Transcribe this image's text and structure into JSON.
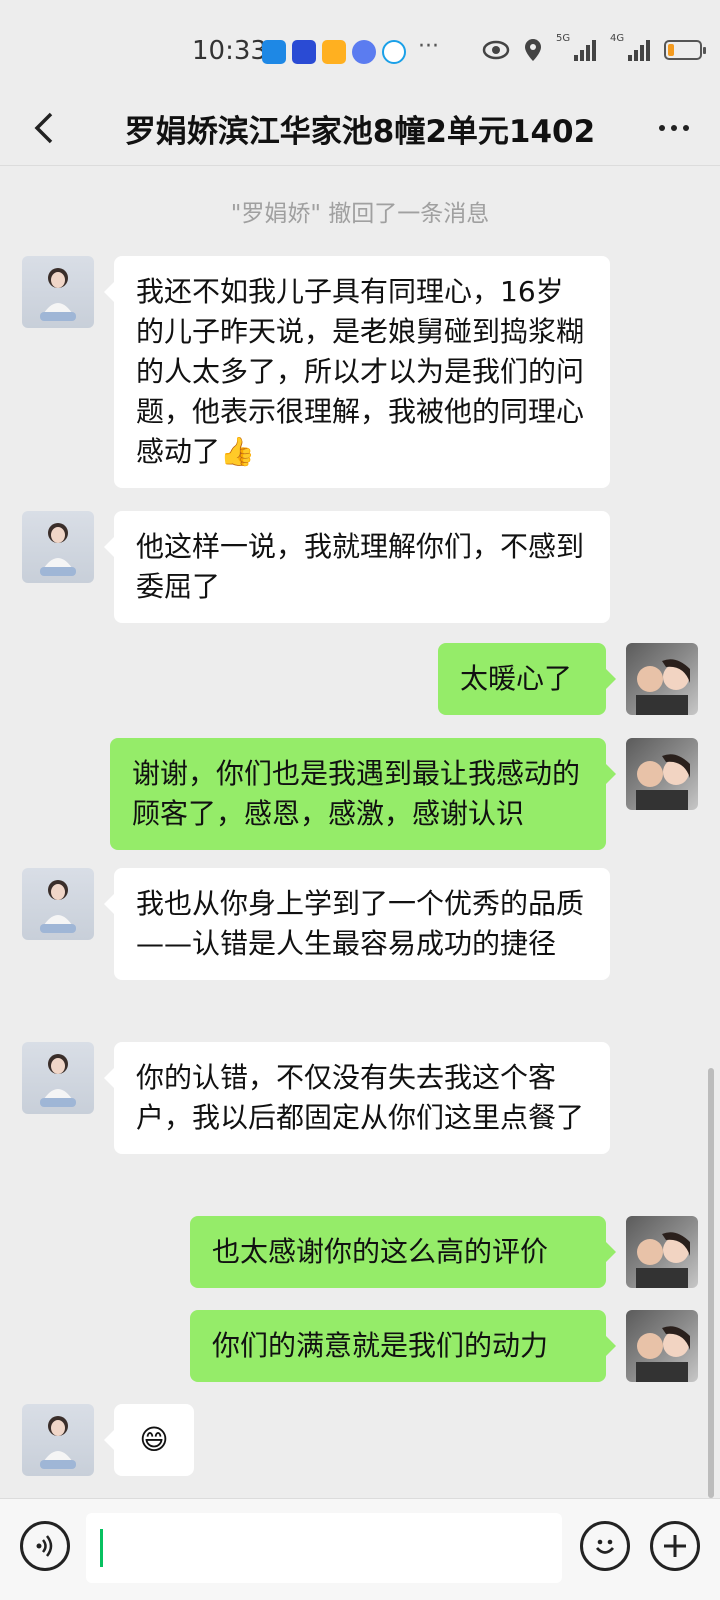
{
  "status_bar": {
    "time": "10:33",
    "network_1": "5G",
    "network_2": "4G",
    "battery_level": 0.2,
    "overflow_dots": "···",
    "icons": [
      "app-blue-icon",
      "app-game-icon",
      "app-orange-icon",
      "app-music-icon",
      "app-chat-icon",
      "eye-icon",
      "location-icon"
    ]
  },
  "header": {
    "title": "罗娟娇滨江华家池8幢2单元1402"
  },
  "messages": {
    "system_notice": "\"罗娟娇\" 撤回了一条消息",
    "m1": "我还不如我儿子具有同理心，16岁的儿子昨天说，是老娘舅碰到捣浆糊的人太多了，所以才以为是我们的问题，他表示很理解，我被他的同理心感动了👍",
    "m2": "他这样一说，我就理解你们，不感到委屈了",
    "m3": "太暖心了",
    "m4": "谢谢，你们也是我遇到最让我感动的顾客了，感恩，感激，感谢认识",
    "m5": "我也从你身上学到了一个优秀的品质——认错是人生最容易成功的捷径",
    "m6": "你的认错，不仅没有失去我这个客户，我以后都固定从你们这里点餐了",
    "m7": "也太感谢你的这么高的评价",
    "m8": "你们的满意就是我们的动力",
    "m9": "😄"
  },
  "input_bar": {
    "value": ""
  },
  "colors": {
    "background": "#ededed",
    "own_bubble": "#95ec69",
    "other_bubble": "#ffffff",
    "caret": "#07c160",
    "battery": "#f39a1e"
  }
}
